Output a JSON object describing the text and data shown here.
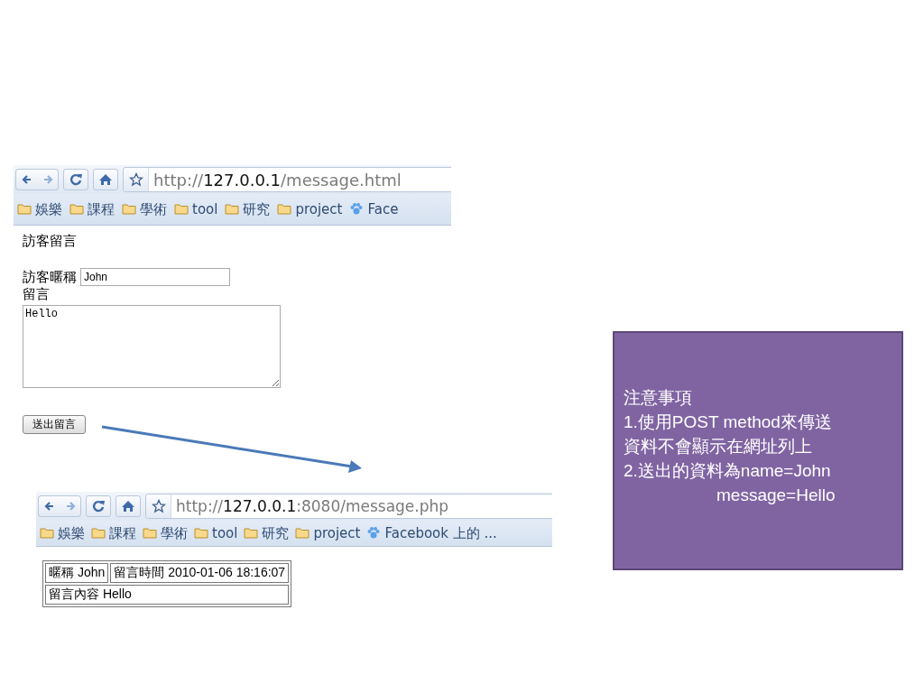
{
  "form_browser": {
    "url": {
      "scheme": "http://",
      "host": "127.0.0.1",
      "path": "/message.html"
    },
    "bookmarks": [
      {
        "label": "娛樂",
        "kind": "folder"
      },
      {
        "label": "課程",
        "kind": "folder"
      },
      {
        "label": "學術",
        "kind": "folder"
      },
      {
        "label": "tool",
        "kind": "folder"
      },
      {
        "label": "研究",
        "kind": "folder"
      },
      {
        "label": "project",
        "kind": "folder"
      },
      {
        "label": "Face",
        "kind": "site"
      }
    ],
    "page": {
      "heading": "訪客留言",
      "nickname_label": "訪客暱稱",
      "nickname_value": "John",
      "message_label": "留言",
      "message_value": "Hello",
      "submit": "送出留言"
    }
  },
  "result_browser": {
    "url": {
      "scheme": "http://",
      "host": "127.0.0.1",
      "path": ":8080/message.php"
    },
    "bookmarks": [
      {
        "label": "娛樂",
        "kind": "folder"
      },
      {
        "label": "課程",
        "kind": "folder"
      },
      {
        "label": "學術",
        "kind": "folder"
      },
      {
        "label": "tool",
        "kind": "folder"
      },
      {
        "label": "研究",
        "kind": "folder"
      },
      {
        "label": "project",
        "kind": "folder"
      },
      {
        "label": "Facebook 上的 ...",
        "kind": "site"
      }
    ],
    "table": {
      "rows": [
        [
          {
            "text": "暱稱 John"
          },
          {
            "text": "留言時間 2010-01-06 18:16:07"
          }
        ],
        [
          {
            "text": "留言內容 Hello",
            "colspan": 2
          }
        ]
      ]
    }
  },
  "note": {
    "lines": [
      {
        "text": "注意事項",
        "indent": false
      },
      {
        "text": "1.使用POST method來傳送",
        "indent": false
      },
      {
        "text": "資料不會顯示在網址列上",
        "indent": false
      },
      {
        "text": "2.送出的資料為name=John",
        "indent": false
      },
      {
        "text": "message=Hello",
        "indent": true
      }
    ]
  }
}
